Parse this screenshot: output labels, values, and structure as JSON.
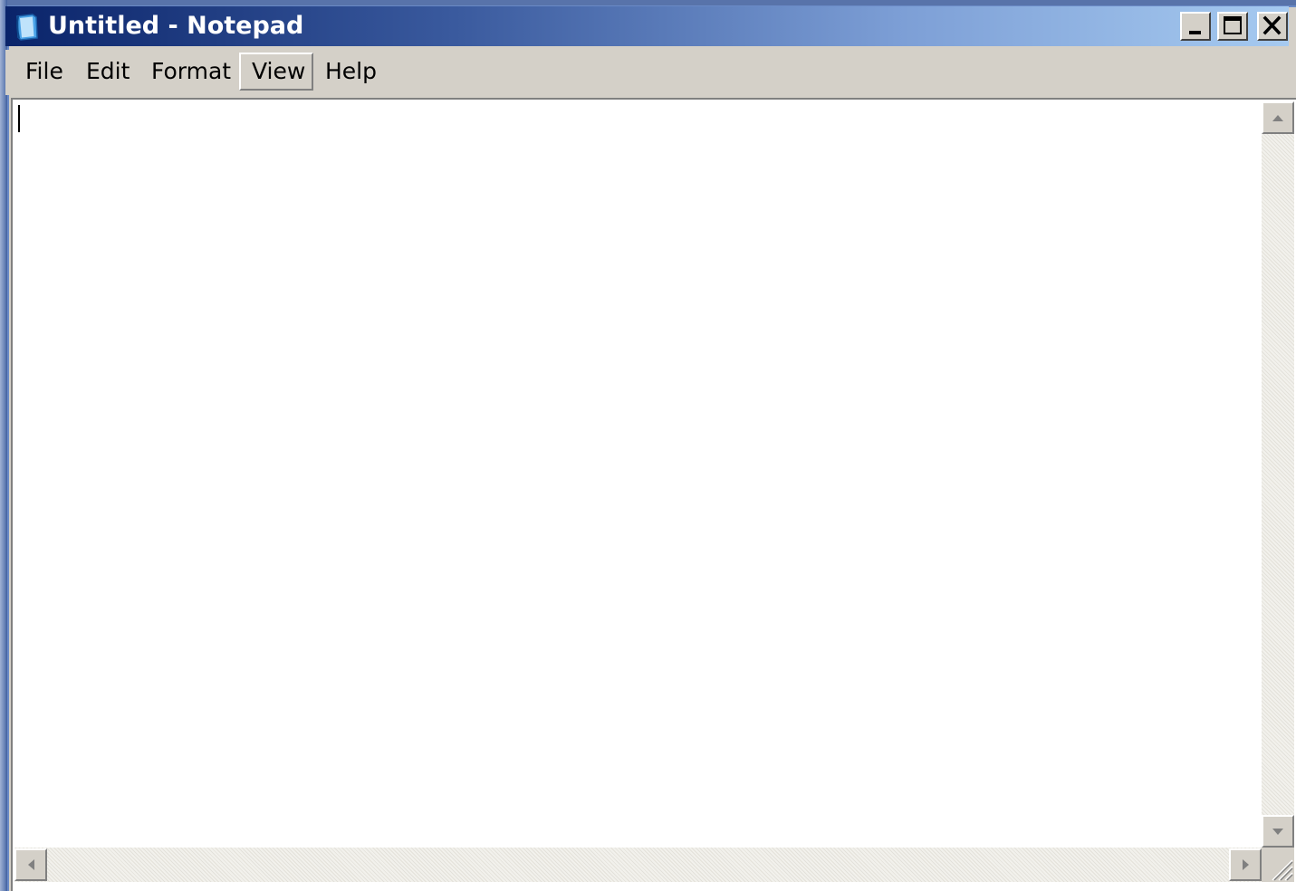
{
  "window": {
    "title": "Untitled - Notepad",
    "icon": "notepad-icon",
    "controls": {
      "minimize": "minimize-icon",
      "maximize": "maximize-icon",
      "close": "close-icon"
    }
  },
  "menu": {
    "items": [
      {
        "label": "File",
        "active": false
      },
      {
        "label": "Edit",
        "active": false
      },
      {
        "label": "Format",
        "active": false
      },
      {
        "label": "View",
        "active": true
      },
      {
        "label": "Help",
        "active": false
      }
    ]
  },
  "editor": {
    "content": ""
  },
  "colors": {
    "titlebar_start": "#0a246a",
    "titlebar_end": "#a6caf0",
    "chrome": "#d4d0c8",
    "editor_bg": "#ffffff"
  }
}
